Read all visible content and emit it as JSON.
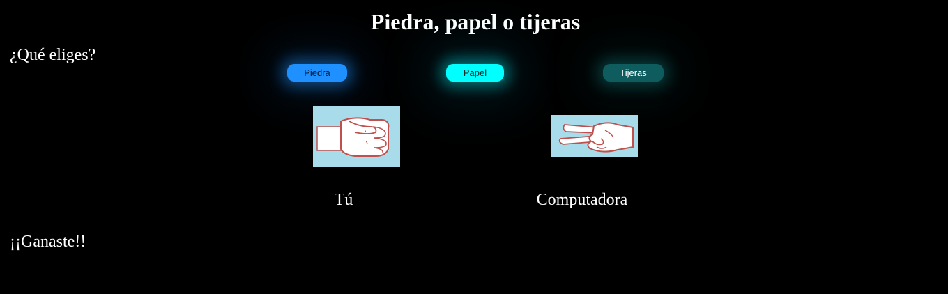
{
  "header": {
    "title": "Piedra, papel o tijeras"
  },
  "prompt": {
    "text": "¿Qué eliges?"
  },
  "choices": [
    {
      "label": "Piedra",
      "color": "#1e90ff"
    },
    {
      "label": "Papel",
      "color": "#00ffff"
    },
    {
      "label": "Tijeras",
      "color": "#0e5c5e"
    }
  ],
  "board": {
    "user": {
      "label": "Tú",
      "hand": "rock-hand-icon"
    },
    "computer": {
      "label": "Computadora",
      "hand": "scissors-hand-icon"
    }
  },
  "result": {
    "text": "¡¡Ganaste!!"
  },
  "colors": {
    "background": "#000000",
    "text": "#ffffff",
    "hand_background": "#a8dcea"
  }
}
